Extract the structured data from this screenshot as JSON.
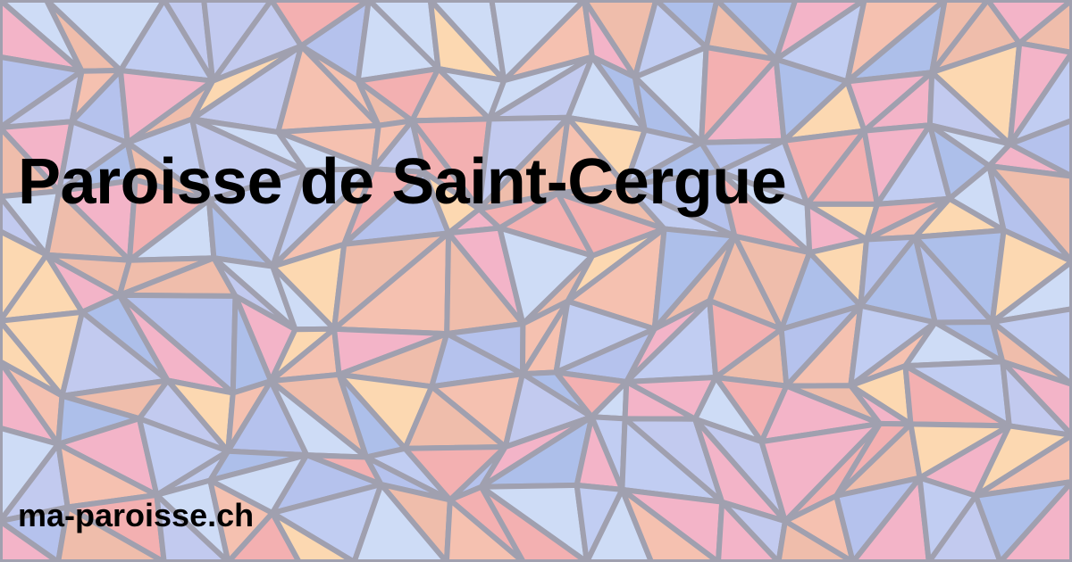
{
  "title": "Paroisse de Saint-Cergue",
  "site": "ma-paroisse.ch",
  "background": {
    "pattern": "stained-glass-mosaic",
    "lead_color": "#8f8fa0",
    "palette": [
      "#f4a3a3",
      "#f7b8a2",
      "#ffd3a3",
      "#a9b9ec",
      "#b7c6f2",
      "#9fb5e8",
      "#f5a8bf",
      "#c7d8f7",
      "#f0b29b",
      "#b9c3ee"
    ]
  }
}
